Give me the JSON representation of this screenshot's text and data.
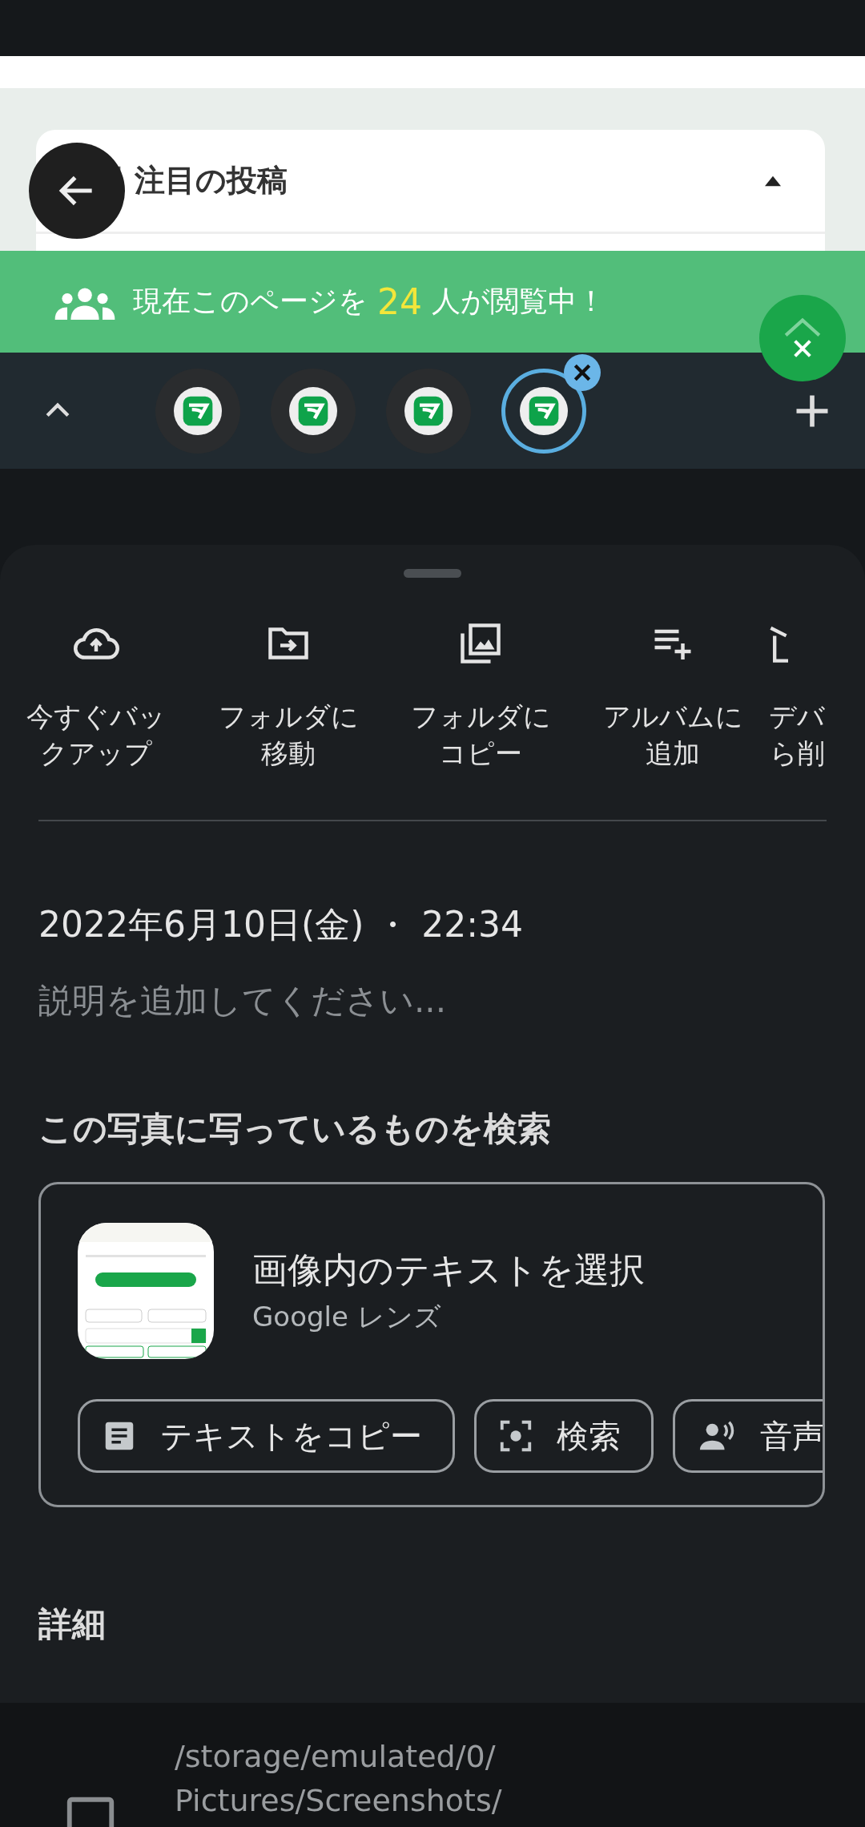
{
  "page_preview": {
    "card_title": "注目の投稿",
    "expanded": true,
    "banner": {
      "prefix": "現在このページを",
      "count": "24",
      "suffix": "人が閲覧中！"
    },
    "bubbles": [
      {
        "selected": false
      },
      {
        "selected": false
      },
      {
        "selected": false
      },
      {
        "selected": true
      }
    ]
  },
  "actions": [
    {
      "kind": "backup",
      "lines": [
        "今すぐバッ",
        "クアップ"
      ]
    },
    {
      "kind": "move",
      "lines": [
        "フォルダに",
        "移動"
      ]
    },
    {
      "kind": "copy",
      "lines": [
        "フォルダに",
        "コピー"
      ]
    },
    {
      "kind": "album",
      "lines": [
        "アルバムに",
        "追加"
      ]
    },
    {
      "kind": "delete",
      "lines": [
        "デバ",
        "ら削"
      ]
    }
  ],
  "date": "2022年6月10日(金) ・ 22:34",
  "description": {
    "placeholder": "説明を追加してください..."
  },
  "lens_section": {
    "heading": "この写真に写っているものを検索",
    "title": "画像内のテキストを選択",
    "subtitle": "Google レンズ",
    "chips": [
      {
        "kind": "copy",
        "label": "テキストをコピー"
      },
      {
        "kind": "search",
        "label": "検索"
      },
      {
        "kind": "listen",
        "label": "音声"
      }
    ]
  },
  "details": {
    "heading": "詳細",
    "path_lines": [
      "/storage/emulated/0/",
      "Pictures/Screenshots/"
    ]
  }
}
